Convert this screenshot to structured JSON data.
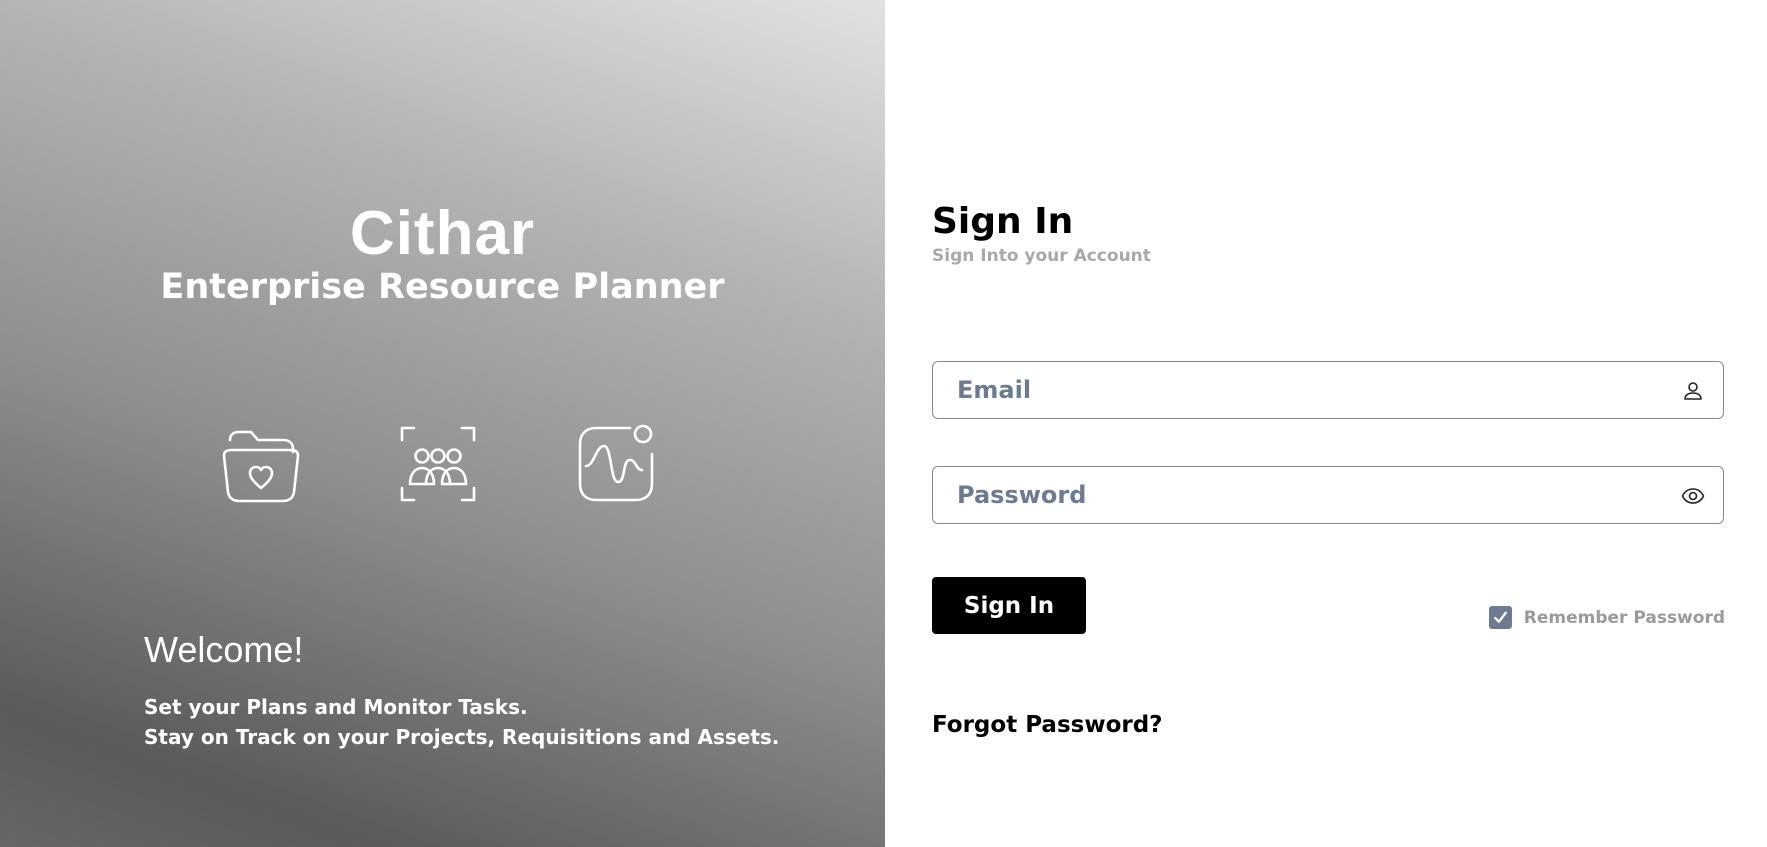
{
  "hero": {
    "brand": "Cithar",
    "tagline": "Enterprise Resource Planner",
    "icons": [
      "folder-heart-icon",
      "team-focus-icon",
      "activity-signal-icon"
    ],
    "welcome": "Welcome!",
    "blurb_lines": [
      "Set your Plans and Monitor Tasks.",
      "Stay on Track on your Projects, Requisitions and Assets."
    ]
  },
  "signin": {
    "title": "Sign In",
    "subtitle": "Sign Into your Account",
    "email_placeholder": "Email",
    "email_icon": "user-icon",
    "password_placeholder": "Password",
    "password_icon": "eye-icon",
    "submit_label": "Sign In",
    "remember_label": "Remember Password",
    "remember_checked": true,
    "forgot_label": "Forgot Password?"
  },
  "colors": {
    "primary_button": "#000000",
    "input_text": "#6d7a90",
    "checkbox": "#6d7a90",
    "muted_text": "#a8a8a8"
  }
}
